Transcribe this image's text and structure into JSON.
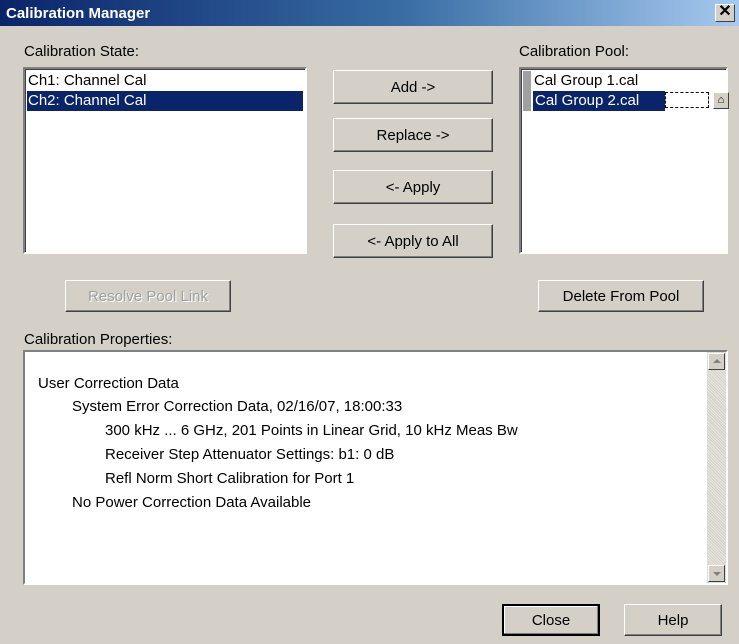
{
  "window": {
    "title": "Calibration Manager",
    "close_glyph": "✕"
  },
  "state": {
    "label": "Calibration State:",
    "items": [
      {
        "label": "Ch1: Channel Cal",
        "selected": false
      },
      {
        "label": "Ch2: Channel Cal",
        "selected": true
      }
    ]
  },
  "pool": {
    "label": "Calibration Pool:",
    "items": [
      {
        "label": "Cal Group 1.cal",
        "selected": false
      },
      {
        "label": "Cal Group 2.cal",
        "selected": true
      }
    ],
    "icon": "folder-icon"
  },
  "buttons": {
    "add": "Add ->",
    "replace": "Replace ->",
    "apply": "<- Apply",
    "apply_all": "<- Apply to All",
    "resolve": "Resolve Pool Link",
    "delete": "Delete From Pool",
    "close": "Close",
    "help": "Help"
  },
  "properties": {
    "label": "Calibration Properties:",
    "lines": [
      "User Correction Data",
      "System Error Correction Data, 02/16/07, 18:00:33",
      "300 kHz ... 6 GHz, 201 Points in Linear Grid, 10 kHz Meas Bw",
      "Receiver Step Attenuator Settings: b1: 0 dB",
      "Refl Norm Short Calibration for Port 1",
      "No Power Correction Data Available"
    ]
  },
  "colors": {
    "selection": "#0a246a",
    "face": "#d4d0c8"
  }
}
